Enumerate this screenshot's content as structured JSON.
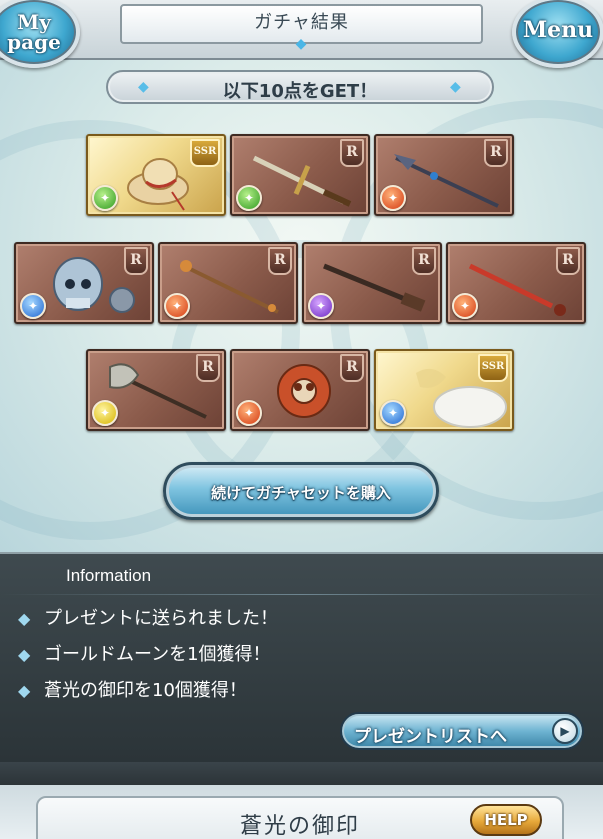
{
  "header": {
    "title": "ガチャ結果",
    "mypage_label_line1": "My",
    "mypage_label_line2": "page",
    "menu_label": "Menu"
  },
  "result_banner": {
    "text": "以下10点をGET！"
  },
  "items": [
    {
      "rarity": "SSR",
      "element": "wind",
      "element_icon": "wind-icon",
      "depicts": "straw hat"
    },
    {
      "rarity": "R",
      "element": "wind",
      "element_icon": "wind-icon",
      "depicts": "sword"
    },
    {
      "rarity": "R",
      "element": "fire",
      "element_icon": "fire-icon",
      "depicts": "spear"
    },
    {
      "rarity": "R",
      "element": "water",
      "element_icon": "water-icon",
      "depicts": "armored skeleton"
    },
    {
      "rarity": "R",
      "element": "fire",
      "element_icon": "fire-icon",
      "depicts": "staff"
    },
    {
      "rarity": "R",
      "element": "dark",
      "element_icon": "dark-icon",
      "depicts": "gun"
    },
    {
      "rarity": "R",
      "element": "fire",
      "element_icon": "fire-icon",
      "depicts": "blade"
    },
    {
      "rarity": "R",
      "element": "light",
      "element_icon": "light-icon",
      "depicts": "axe"
    },
    {
      "rarity": "R",
      "element": "fire",
      "element_icon": "fire-icon",
      "depicts": "bladed disc"
    },
    {
      "rarity": "SSR",
      "element": "water",
      "element_icon": "water-icon",
      "depicts": "white creature"
    }
  ],
  "buy_more_button": {
    "label": "続けてガチャセットを購入"
  },
  "information": {
    "heading": "Information",
    "lines": [
      "プレゼントに送られました！",
      "ゴールドムーンを1個獲得！",
      "蒼光の御印を10個獲得！"
    ],
    "present_list_button": "プレゼントリストへ"
  },
  "bottom": {
    "panel_title": "蒼光の御印",
    "help_label": "HELP"
  },
  "colors": {
    "panel_dark": "#2f383c",
    "accent_blue": "#3f93ba",
    "r_card": "#8b5b4b",
    "ssr_card": "#f0d98c"
  }
}
